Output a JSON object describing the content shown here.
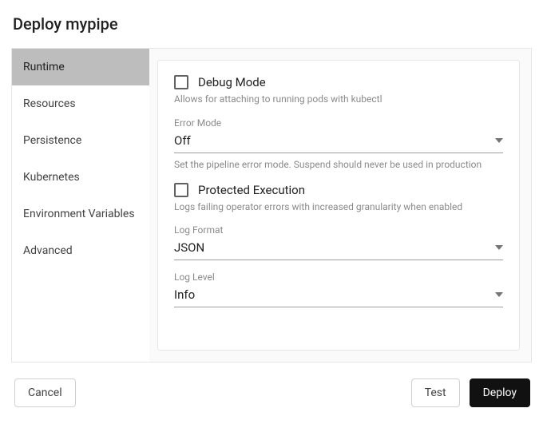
{
  "title": "Deploy mypipe",
  "tabs": [
    {
      "label": "Runtime",
      "active": true
    },
    {
      "label": "Resources",
      "active": false
    },
    {
      "label": "Persistence",
      "active": false
    },
    {
      "label": "Kubernetes",
      "active": false
    },
    {
      "label": "Environment Variables",
      "active": false
    },
    {
      "label": "Advanced",
      "active": false
    }
  ],
  "form": {
    "debug_mode": {
      "label": "Debug Mode",
      "checked": false,
      "hint": "Allows for attaching to running pods with kubectl"
    },
    "error_mode": {
      "label": "Error Mode",
      "value": "Off",
      "hint": "Set the pipeline error mode. Suspend should never be used in production"
    },
    "protected_execution": {
      "label": "Protected Execution",
      "checked": false,
      "hint": "Logs failing operator errors with increased granularity when enabled"
    },
    "log_format": {
      "label": "Log Format",
      "value": "JSON"
    },
    "log_level": {
      "label": "Log Level",
      "value": "Info"
    }
  },
  "footer": {
    "cancel": "Cancel",
    "test": "Test",
    "deploy": "Deploy"
  }
}
